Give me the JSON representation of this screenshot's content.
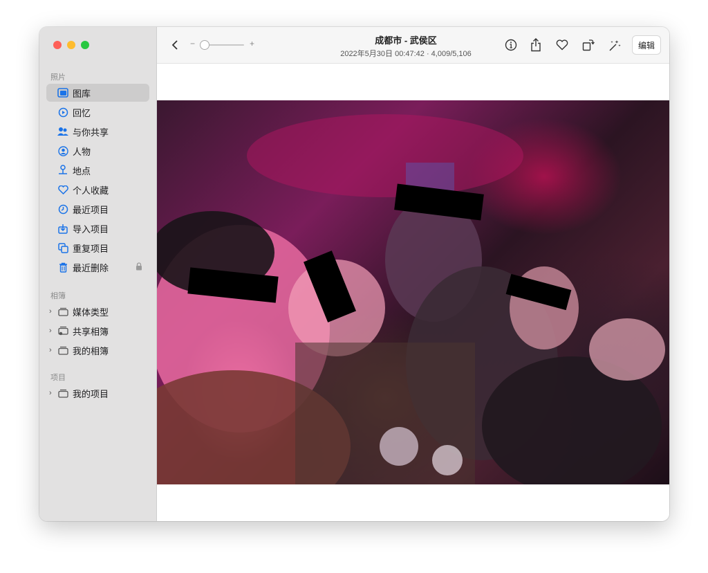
{
  "sidebar": {
    "sections": {
      "photos": "照片",
      "albums": "相簿",
      "projects": "项目"
    },
    "photos_items": [
      {
        "label": "图库",
        "icon": "photo-library-icon"
      },
      {
        "label": "回忆",
        "icon": "memories-icon"
      },
      {
        "label": "与你共享",
        "icon": "shared-with-you-icon"
      },
      {
        "label": "人物",
        "icon": "people-icon"
      },
      {
        "label": "地点",
        "icon": "places-icon"
      },
      {
        "label": "个人收藏",
        "icon": "heart-icon"
      },
      {
        "label": "最近项目",
        "icon": "clock-icon"
      },
      {
        "label": "导入项目",
        "icon": "import-icon"
      },
      {
        "label": "重复项目",
        "icon": "duplicates-icon"
      },
      {
        "label": "最近删除",
        "icon": "trash-icon"
      }
    ],
    "album_items": [
      {
        "label": "媒体类型"
      },
      {
        "label": "共享相簿"
      },
      {
        "label": "我的相簿"
      }
    ],
    "project_items": [
      {
        "label": "我的项目"
      }
    ]
  },
  "toolbar": {
    "title": "成都市 - 武侯区",
    "subtitle": "2022年5月30日 00:47:42 · 4,009/5,106",
    "zoom_minus": "−",
    "zoom_plus": "+",
    "edit_label": "编辑"
  },
  "colors": {
    "accent": "#1a73e8",
    "close": "#fe5f57",
    "minimize": "#febc2e",
    "zoom": "#28c840"
  }
}
